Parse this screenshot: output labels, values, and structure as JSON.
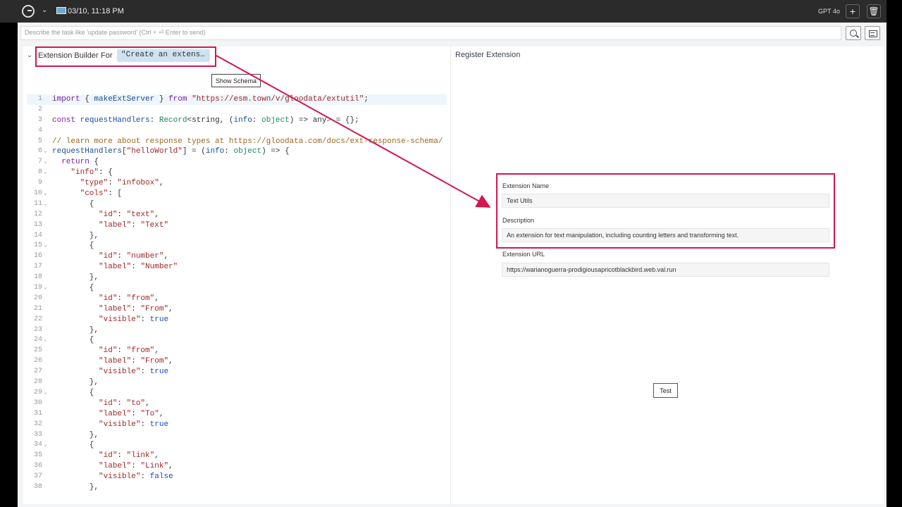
{
  "topbar": {
    "datetime": "03/10, 11:18 PM",
    "model": "GPT 4o",
    "icons": [
      "logo-icon",
      "chevron-down-icon",
      "laptop-icon",
      "plus-icon",
      "trash-icon"
    ]
  },
  "task_input": {
    "placeholder": "Describe the task like 'update password' (Ctrl + ⏎ Enter to send)"
  },
  "builder": {
    "title": "Extension Builder",
    "for_label": "For",
    "prompt": "\"Create an extensi…",
    "show_schema": "Show Schema"
  },
  "code_lines": [
    {
      "n": "1",
      "fold": false,
      "html": "<span class=\"k\">import</span> { <span class=\"f\">makeExtServer</span> } <span class=\"k\">from</span> <span class=\"s\">\"https://esm.town/v/gloodata/extutil\"</span>;"
    },
    {
      "n": "2",
      "fold": false,
      "html": ""
    },
    {
      "n": "3",
      "fold": false,
      "html": "<span class=\"k\">const</span> <span class=\"f\">requestHandlers</span>: <span class=\"t\">Record</span>&lt;string, (<span class=\"f\">info</span>: <span class=\"t\">object</span>) =&gt; any&gt; = {};"
    },
    {
      "n": "4",
      "fold": false,
      "html": ""
    },
    {
      "n": "5",
      "fold": false,
      "html": "<span class=\"c\">// learn more about response types at https://gloodata.com/docs/ext-response-schema/</span>"
    },
    {
      "n": "6",
      "fold": true,
      "html": "<span class=\"f\">requestHandlers</span>[<span class=\"s\">\"helloWorld\"</span>] = (<span class=\"f\">info</span>: <span class=\"t\">object</span>) =&gt; {"
    },
    {
      "n": "7",
      "fold": true,
      "html": "  <span class=\"k\">return</span> {"
    },
    {
      "n": "8",
      "fold": true,
      "html": "    <span class=\"s\">\"info\"</span>: {"
    },
    {
      "n": "9",
      "fold": false,
      "html": "      <span class=\"s\">\"type\"</span>: <span class=\"s\">\"infobox\"</span>,"
    },
    {
      "n": "10",
      "fold": true,
      "html": "      <span class=\"s\">\"cols\"</span>: ["
    },
    {
      "n": "11",
      "fold": true,
      "html": "        {"
    },
    {
      "n": "12",
      "fold": false,
      "html": "          <span class=\"s\">\"id\"</span>: <span class=\"s\">\"text\"</span>,"
    },
    {
      "n": "13",
      "fold": false,
      "html": "          <span class=\"s\">\"label\"</span>: <span class=\"s\">\"Text\"</span>"
    },
    {
      "n": "14",
      "fold": false,
      "html": "        },"
    },
    {
      "n": "15",
      "fold": true,
      "html": "        {"
    },
    {
      "n": "16",
      "fold": false,
      "html": "          <span class=\"s\">\"id\"</span>: <span class=\"s\">\"number\"</span>,"
    },
    {
      "n": "17",
      "fold": false,
      "html": "          <span class=\"s\">\"label\"</span>: <span class=\"s\">\"Number\"</span>"
    },
    {
      "n": "18",
      "fold": false,
      "html": "        },"
    },
    {
      "n": "19",
      "fold": true,
      "html": "        {"
    },
    {
      "n": "20",
      "fold": false,
      "html": "          <span class=\"s\">\"id\"</span>: <span class=\"s\">\"from\"</span>,"
    },
    {
      "n": "21",
      "fold": false,
      "html": "          <span class=\"s\">\"label\"</span>: <span class=\"s\">\"From\"</span>,"
    },
    {
      "n": "22",
      "fold": false,
      "html": "          <span class=\"s\">\"visible\"</span>: <span class=\"b\">true</span>"
    },
    {
      "n": "23",
      "fold": false,
      "html": "        },"
    },
    {
      "n": "24",
      "fold": true,
      "html": "        {"
    },
    {
      "n": "25",
      "fold": false,
      "html": "          <span class=\"s\">\"id\"</span>: <span class=\"s\">\"from\"</span>,"
    },
    {
      "n": "26",
      "fold": false,
      "html": "          <span class=\"s\">\"label\"</span>: <span class=\"s\">\"From\"</span>,"
    },
    {
      "n": "27",
      "fold": false,
      "html": "          <span class=\"s\">\"visible\"</span>: <span class=\"b\">true</span>"
    },
    {
      "n": "28",
      "fold": false,
      "html": "        },"
    },
    {
      "n": "29",
      "fold": true,
      "html": "        {"
    },
    {
      "n": "30",
      "fold": false,
      "html": "          <span class=\"s\">\"id\"</span>: <span class=\"s\">\"to\"</span>,"
    },
    {
      "n": "31",
      "fold": false,
      "html": "          <span class=\"s\">\"label\"</span>: <span class=\"s\">\"To\"</span>,"
    },
    {
      "n": "32",
      "fold": false,
      "html": "          <span class=\"s\">\"visible\"</span>: <span class=\"b\">true</span>"
    },
    {
      "n": "33",
      "fold": false,
      "html": "        },"
    },
    {
      "n": "34",
      "fold": true,
      "html": "        {"
    },
    {
      "n": "35",
      "fold": false,
      "html": "          <span class=\"s\">\"id\"</span>: <span class=\"s\">\"link\"</span>,"
    },
    {
      "n": "36",
      "fold": false,
      "html": "          <span class=\"s\">\"label\"</span>: <span class=\"s\">\"Link\"</span>,"
    },
    {
      "n": "37",
      "fold": false,
      "html": "          <span class=\"s\">\"visible\"</span>: <span class=\"b\">false</span>"
    },
    {
      "n": "38",
      "fold": false,
      "html": "        },"
    }
  ],
  "register": {
    "title": "Register Extension",
    "name_label": "Extension Name",
    "name_value": "Text Utils",
    "desc_label": "Description",
    "desc_value": "An extension for text manipulation, including counting letters and transforming text.",
    "url_label": "Extension URL",
    "url_value": "https://warianoguerra-prodigiousapricotblackbird.web.val.run",
    "test_button": "Test"
  },
  "colors": {
    "highlight": "#d1174f",
    "accent_chip": "#cfe2f3"
  }
}
